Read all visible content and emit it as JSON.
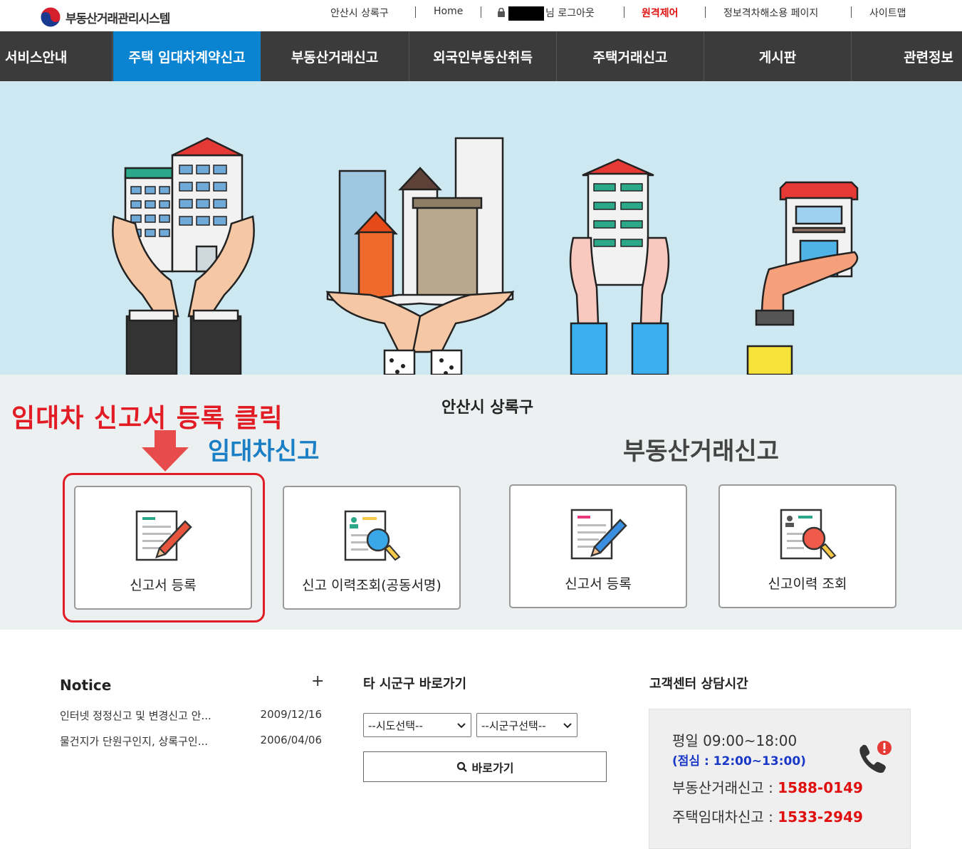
{
  "top": {
    "logo": "부동산거래관리시스템",
    "region": "안산시 상록구",
    "home": "Home",
    "user_suffix": "님 로그아웃",
    "remote": "원격제어",
    "access_page": "정보격차해소용 페이지",
    "sitemap": "사이트맵"
  },
  "nav": [
    {
      "label": "서비스안내"
    },
    {
      "label": "주택 임대차계약신고"
    },
    {
      "label": "부동산거래신고"
    },
    {
      "label": "외국인부동산취득"
    },
    {
      "label": "주택거래신고"
    },
    {
      "label": "게시판"
    },
    {
      "label": "관련정보"
    }
  ],
  "service": {
    "region_title": "안산시 상록구",
    "annotation": "임대차 신고서 등록 클릭",
    "lease_title": "임대차신고",
    "trade_title": "부동산거래신고",
    "cards": [
      {
        "label": "신고서 등록"
      },
      {
        "label": "신고 이력조회(공동서명)"
      },
      {
        "label": "신고서 등록"
      },
      {
        "label": "신고이력 조회"
      }
    ]
  },
  "notice": {
    "title": "Notice",
    "more": "+",
    "items": [
      {
        "title": "인터넷 정정신고 및 변경신고 안...",
        "date": "2009/12/16"
      },
      {
        "title": "물건지가 단원구인지, 상록구인...",
        "date": "2006/04/06"
      }
    ]
  },
  "jump": {
    "title": "타 시군구 바로가기",
    "sido_selected": "--시도선택--",
    "sigungu_selected": "--시군구선택--",
    "go_label": "바로가기"
  },
  "cs": {
    "title": "고객센터 상담시간",
    "hours": "평일 09:00~18:00",
    "lunch": "(점심 : 12:00~13:00)",
    "trade_label": "부동산거래신고 : ",
    "trade_number": "1588-0149",
    "lease_label": "주택임대차신고 : ",
    "lease_number": "1533-2949"
  },
  "colors": {
    "nav_bg": "#3b3b3b",
    "nav_active": "#0a83d0",
    "hero_bg": "#cde8f0",
    "annotation": "#e21c24",
    "lease_title": "#1b7fc5",
    "phone_number": "#e01010"
  }
}
